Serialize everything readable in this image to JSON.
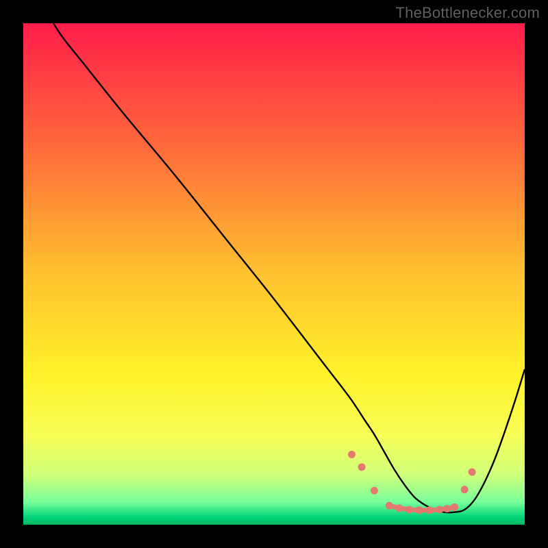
{
  "watermark": "TheBottlenecker.com",
  "chart_data": {
    "type": "line",
    "title": "",
    "xlabel": "",
    "ylabel": "",
    "xlim": [
      0,
      100
    ],
    "ylim": [
      0,
      100
    ],
    "grid": false,
    "background_gradient": {
      "stops": [
        {
          "offset": 0.0,
          "color": "#ff1d4a"
        },
        {
          "offset": 0.25,
          "color": "#ff6b3b"
        },
        {
          "offset": 0.5,
          "color": "#ffc22f"
        },
        {
          "offset": 0.7,
          "color": "#fff22a"
        },
        {
          "offset": 0.82,
          "color": "#f8ff57"
        },
        {
          "offset": 0.9,
          "color": "#d0ff7a"
        },
        {
          "offset": 0.955,
          "color": "#78ff9a"
        },
        {
          "offset": 0.985,
          "color": "#00d47a"
        },
        {
          "offset": 1.0,
          "color": "#00b560"
        }
      ]
    },
    "series": [
      {
        "name": "curve",
        "color": "#000000",
        "x": [
          6,
          8,
          12,
          20,
          30,
          40,
          50,
          60,
          65,
          68,
          70,
          72,
          74,
          76,
          78,
          80,
          82,
          84,
          86,
          88,
          90,
          92,
          94,
          96,
          98,
          100
        ],
        "y": [
          100,
          97,
          92,
          82,
          70,
          57.5,
          45,
          32,
          25.5,
          21,
          18,
          14.5,
          11,
          8,
          5.5,
          4,
          3,
          2.5,
          2.5,
          3,
          5,
          8.5,
          13,
          18.5,
          24.5,
          31
        ]
      }
    ],
    "markers": {
      "name": "dots",
      "color": "#e37a6f",
      "x": [
        65.5,
        67.5,
        70,
        73,
        75,
        77,
        79,
        81,
        83,
        84.5,
        86,
        88,
        89.5
      ],
      "y": [
        14,
        11.5,
        6.8,
        3.8,
        3.3,
        3.0,
        2.9,
        2.9,
        3.0,
        3.2,
        3.5,
        7.0,
        10.5
      ]
    }
  }
}
